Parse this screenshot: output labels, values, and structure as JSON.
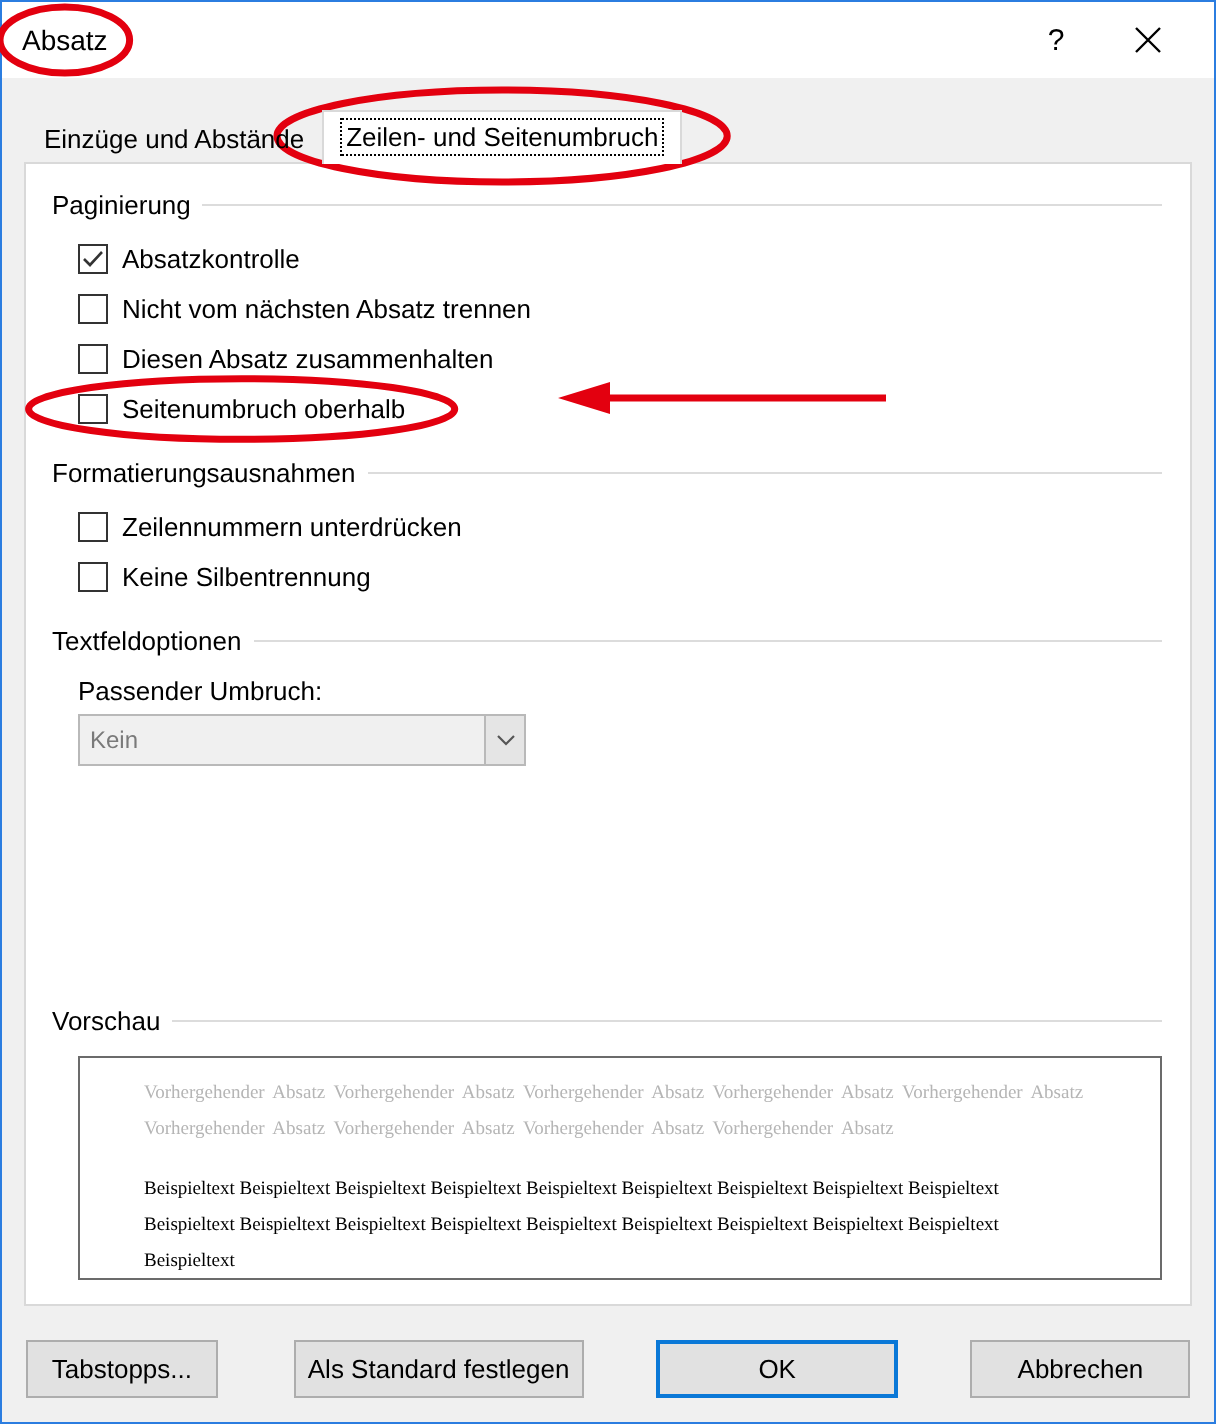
{
  "window": {
    "title": "Absatz",
    "title_highlighted": true,
    "help": "?"
  },
  "tabs": [
    {
      "label": "Einzüge und Abstände",
      "selected": false,
      "highlighted": false
    },
    {
      "label": "Zeilen- und Seitenumbruch",
      "selected": true,
      "highlighted": true
    }
  ],
  "sections": [
    {
      "title": "Paginierung",
      "checkboxes": [
        {
          "label": "Absatzkontrolle",
          "checked": true,
          "highlighted": false,
          "arrow": false
        },
        {
          "label": "Nicht vom nächsten Absatz trennen",
          "checked": false,
          "highlighted": false,
          "arrow": false
        },
        {
          "label": "Diesen Absatz zusammenhalten",
          "checked": false,
          "highlighted": false,
          "arrow": false
        },
        {
          "label": "Seitenumbruch oberhalb",
          "checked": false,
          "highlighted": true,
          "arrow": true
        }
      ]
    },
    {
      "title": "Formatierungsausnahmen",
      "checkboxes": [
        {
          "label": "Zeilennummern unterdrücken",
          "checked": false,
          "highlighted": false,
          "arrow": false
        },
        {
          "label": "Keine Silbentrennung",
          "checked": false,
          "highlighted": false,
          "arrow": false
        }
      ]
    },
    {
      "title": "Textfeldoptionen",
      "dropdown": {
        "label": "Passender Umbruch:",
        "value": "Kein",
        "disabled": true
      }
    }
  ],
  "preview": {
    "title": "Vorschau",
    "previous": "Vorhergehender Absatz Vorhergehender Absatz Vorhergehender Absatz Vorhergehender Absatz Vorhergehender Absatz Vorhergehender Absatz Vorhergehender Absatz Vorhergehender Absatz Vorhergehender Absatz",
    "sample": "Beispieltext Beispieltext Beispieltext Beispieltext Beispieltext Beispieltext Beispieltext Beispieltext Beispieltext Beispieltext Beispieltext Beispieltext Beispieltext Beispieltext Beispieltext Beispieltext Beispieltext Beispieltext Beispieltext"
  },
  "buttons": [
    {
      "label": "Tabstopps...",
      "kind": "secondary"
    },
    {
      "label": "Als Standard festlegen",
      "kind": "secondary"
    },
    {
      "label": "OK",
      "kind": "default"
    },
    {
      "label": "Abbrechen",
      "kind": "normal"
    }
  ]
}
